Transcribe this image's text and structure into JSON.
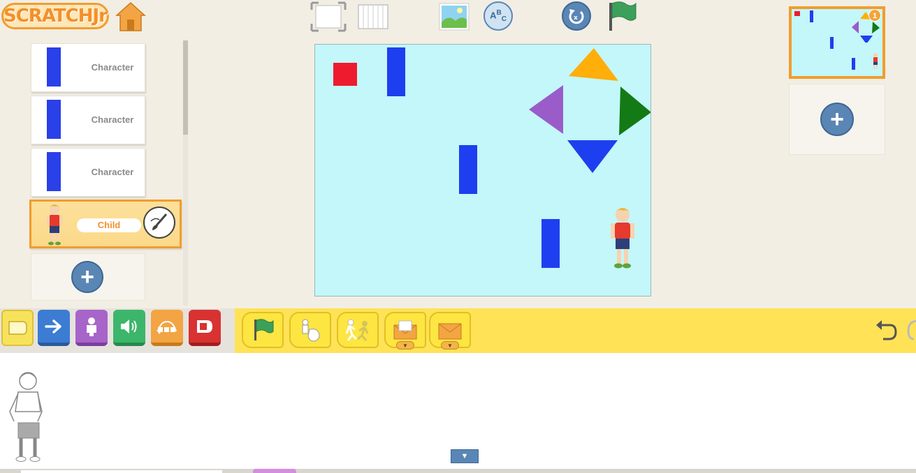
{
  "app": {
    "logo_text": "SCRATCHJr"
  },
  "toolbar": {
    "icons": [
      "home-icon",
      "fullscreen-icon",
      "grid-icon",
      "background-icon",
      "text-icon",
      "reset-icon",
      "green-flag-icon"
    ]
  },
  "characters": [
    {
      "label": "Character"
    },
    {
      "label": "Character"
    },
    {
      "label": "Character"
    },
    {
      "label": "Child",
      "selected": true
    }
  ],
  "pages": {
    "current_number": "1"
  },
  "categories": [
    {
      "name": "triggering",
      "color": "#f7e25c"
    },
    {
      "name": "motion",
      "color": "#3c7cd3"
    },
    {
      "name": "looks",
      "color": "#a764c9"
    },
    {
      "name": "sound",
      "color": "#3cb66a"
    },
    {
      "name": "control",
      "color": "#f3a443"
    },
    {
      "name": "end",
      "color": "#d83232"
    }
  ],
  "blocks": [
    "start-on-green-flag",
    "start-on-tap",
    "start-on-bump",
    "send-message",
    "start-on-message"
  ],
  "colors": {
    "stage_bg": "#c3f7f9",
    "palette_bar": "#ffe256",
    "accent": "#f29c2e"
  }
}
